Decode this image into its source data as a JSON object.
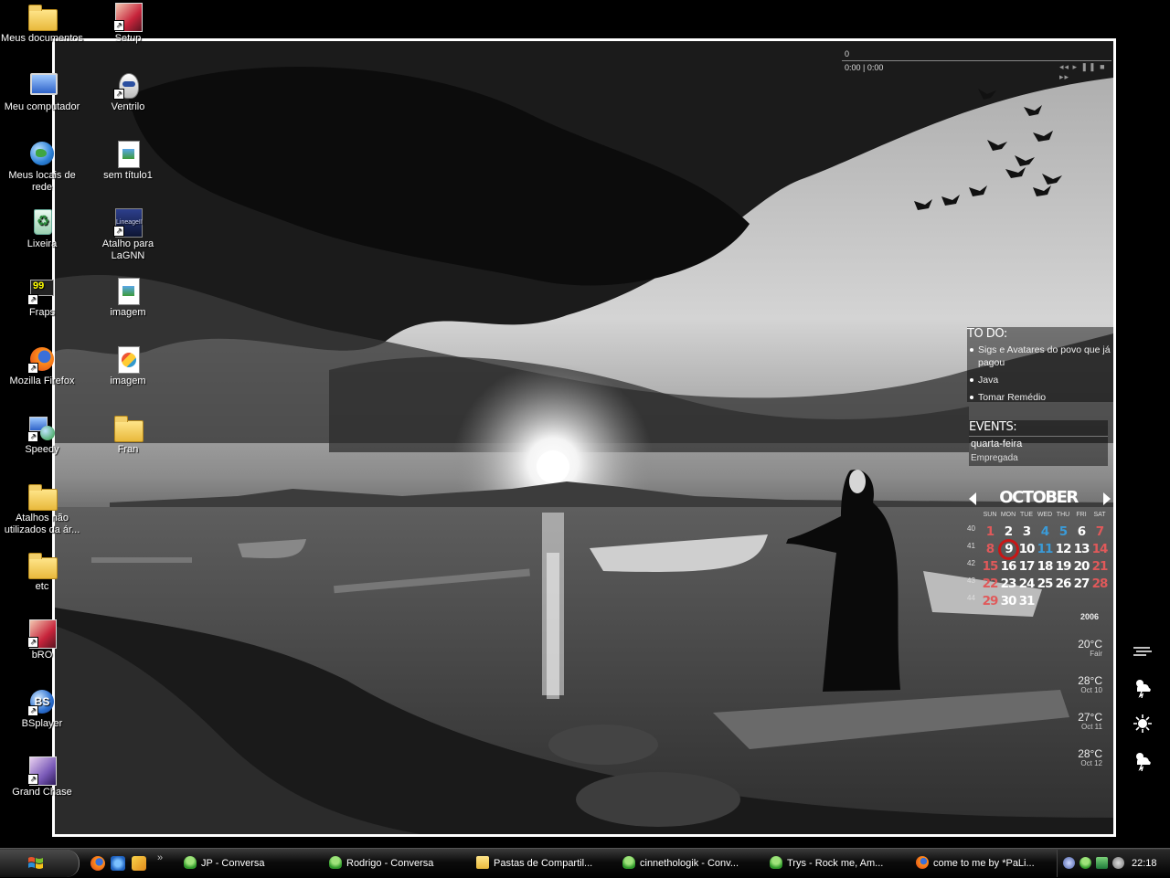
{
  "desktop": {
    "icons_col1": [
      {
        "label": "Meus documentos",
        "icon": "my-documents-icon"
      },
      {
        "label": "Meu computador",
        "icon": "my-computer-icon"
      },
      {
        "label": "Meus locais de rede",
        "icon": "network-places-icon"
      },
      {
        "label": "Lixeira",
        "icon": "recycle-bin-icon"
      },
      {
        "label": "Fraps",
        "icon": "fraps-icon"
      },
      {
        "label": "Mozilla Firefox",
        "icon": "firefox-icon"
      },
      {
        "label": "Speedy",
        "icon": "speedy-icon"
      },
      {
        "label": "Atalhos não utilizados da ár...",
        "icon": "folder-icon"
      },
      {
        "label": "etc",
        "icon": "folder-icon"
      },
      {
        "label": "bRO",
        "icon": "bro-game-icon"
      },
      {
        "label": "BSplayer",
        "icon": "bsplayer-icon"
      },
      {
        "label": "Grand Chase",
        "icon": "grand-chase-icon"
      }
    ],
    "icons_col2": [
      {
        "label": "Setup",
        "icon": "setup-icon"
      },
      {
        "label": "Ventrilo",
        "icon": "ventrilo-icon"
      },
      {
        "label": "sem título1",
        "icon": "image-file-icon"
      },
      {
        "label": "Atalho para LaGNN",
        "icon": "lineage-icon"
      },
      {
        "label": "imagem",
        "icon": "image-file-icon"
      },
      {
        "label": "imagem",
        "icon": "paint-file-icon"
      },
      {
        "label": "Fran",
        "icon": "folder-icon"
      }
    ],
    "shortcut_glyph": "↗",
    "fraps_glyph": "99",
    "bs_glyph": "BS",
    "lineage_glyph": "LineageII",
    "recycle_glyph": "♻"
  },
  "media_player": {
    "track_count": "0",
    "time": "0:00  |  0:00",
    "controls": "◂◂ ▸ ❚❚ ■ ▸▸"
  },
  "todo": {
    "title": "TO DO:",
    "items": [
      "Sigs e Avatares do povo que já pagou",
      "Java",
      "Tomar Remédio"
    ]
  },
  "events": {
    "title": "EVENTS:",
    "day": "quarta-feira",
    "event": "Empregada"
  },
  "calendar": {
    "month": "OCTOBER",
    "year": "2006",
    "weekdays": [
      "SUN",
      "MON",
      "TUE",
      "WED",
      "THU",
      "FRI",
      "SAT"
    ],
    "weeks": [
      "40",
      "41",
      "42",
      "43",
      "44"
    ],
    "rows": [
      [
        "1",
        "2",
        "3",
        "4",
        "5",
        "6",
        "7"
      ],
      [
        "8",
        "9",
        "10",
        "11",
        "12",
        "13",
        "14"
      ],
      [
        "15",
        "16",
        "17",
        "18",
        "19",
        "20",
        "21"
      ],
      [
        "22",
        "23",
        "24",
        "25",
        "26",
        "27",
        "28"
      ],
      [
        "29",
        "30",
        "31",
        "",
        "",
        "",
        ""
      ]
    ],
    "today": "9",
    "highlight_blue": [
      "4",
      "5",
      "11"
    ],
    "weekend_color": "#e0595a",
    "today_ring_color": "#c81616"
  },
  "weather": [
    {
      "temp": "20°C",
      "label": "Fair",
      "icon": "wind-icon"
    },
    {
      "temp": "28°C",
      "label": "Oct 10",
      "icon": "storm-icon"
    },
    {
      "temp": "27°C",
      "label": "Oct 11",
      "icon": "sun-icon"
    },
    {
      "temp": "28°C",
      "label": "Oct 12",
      "icon": "storm-icon"
    }
  ],
  "taskbar": {
    "start_icon": "windows-flag-icon",
    "quick_launch": [
      "firefox-icon",
      "ie-icon",
      "winamp-icon"
    ],
    "overflow": "»",
    "buttons": [
      {
        "label": "JP - Conversa",
        "icon": "msn-icon"
      },
      {
        "label": "Rodrigo - Conversa",
        "icon": "msn-icon"
      },
      {
        "label": "Pastas de Compartil...",
        "icon": "folder-icon"
      },
      {
        "label": "cinnethologik - Conv...",
        "icon": "msn-icon"
      },
      {
        "label": "Trys - Rock me,  Am...",
        "icon": "msn-icon"
      },
      {
        "label": "come to me by *PaLi...",
        "icon": "firefox-icon"
      }
    ],
    "clock": "22:18"
  }
}
